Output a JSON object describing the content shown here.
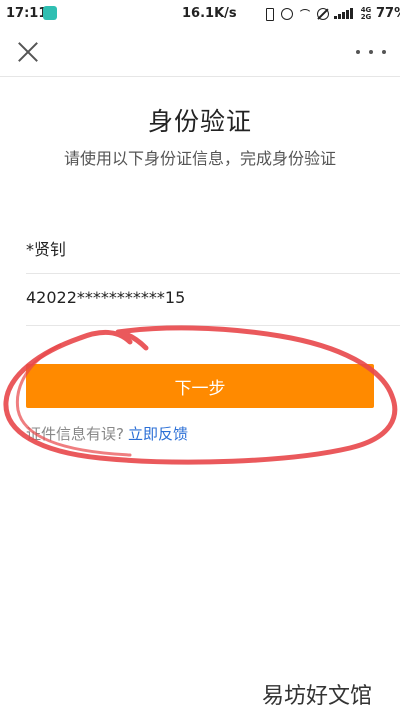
{
  "status_bar": {
    "time": "17:11",
    "net_speed": "16.1K/s",
    "network_type_top": "4G",
    "network_type_bottom": "2G",
    "battery_percent": "77%",
    "icons": [
      "app-notification-icon",
      "vibrate-icon",
      "alarm-icon",
      "wifi-icon",
      "do-not-disturb-icon",
      "signal-icon",
      "battery-icon"
    ]
  },
  "nav": {
    "close_icon": "close-icon",
    "more_icon": "more-icon"
  },
  "page": {
    "title": "身份验证",
    "subtitle": "请使用以下身份证信息，完成身份验证"
  },
  "form": {
    "name_value": "*贤钊",
    "id_value": "42022***********15"
  },
  "actions": {
    "next_label": "下一步",
    "error_hint": "证件信息有误?",
    "feedback_link": "立即反馈"
  },
  "colors": {
    "button": "#ff8a00",
    "link": "#2b6fd6",
    "annotation": "#e8474a"
  },
  "watermark": "易坊好文馆"
}
